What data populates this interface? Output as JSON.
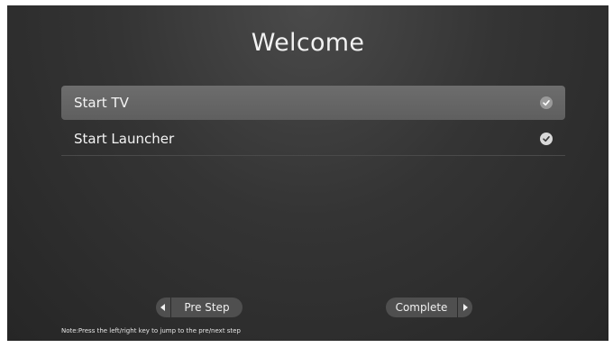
{
  "screen": {
    "title": "Welcome"
  },
  "options": [
    {
      "label": "Start TV",
      "selected": true,
      "checked": true
    },
    {
      "label": "Start Launcher",
      "selected": false,
      "checked": true
    }
  ],
  "buttons": {
    "pre_step": "Pre Step",
    "complete": "Complete"
  },
  "note": "Note:Press the left/right key to jump to the pre/next step",
  "icons": {
    "option_check": "check-circle-icon",
    "pre_arrow": "arrow-left-icon",
    "next_arrow": "arrow-right-icon"
  },
  "colors": {
    "background": "#2e2e2e",
    "selected_row": "#666666",
    "button": "#4f4f4f",
    "text": "#f2f2f2"
  }
}
